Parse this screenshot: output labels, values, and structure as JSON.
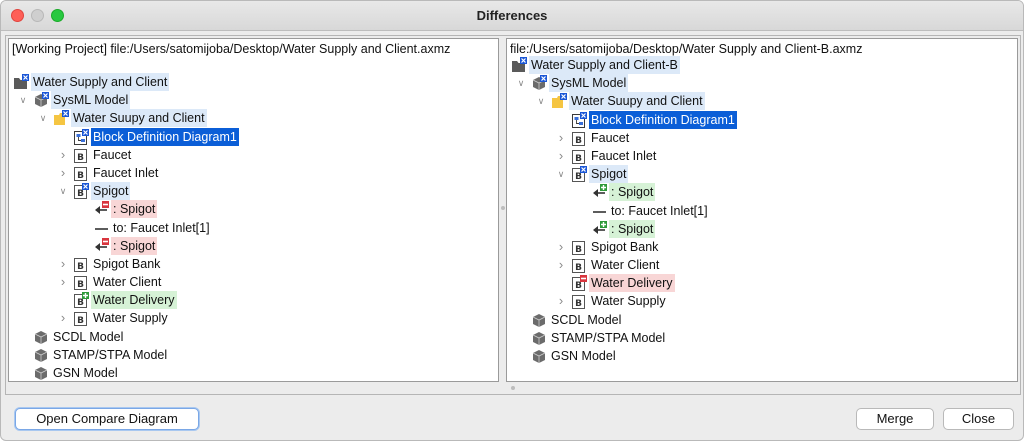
{
  "window": {
    "title": "Differences"
  },
  "left_pane": {
    "header": "[Working Project] file:/Users/satomijoba/Desktop/Water Supply and Client.axmz",
    "rows": [
      {
        "label": "Water Supply and Client",
        "icon": "project-changed-icon",
        "chevron": "",
        "level": 0,
        "state": "chg"
      },
      {
        "label": "SysML Model",
        "icon": "model-changed-icon",
        "chevron": "down",
        "level": 1,
        "state": "chg"
      },
      {
        "label": "Water Suupy and Client",
        "icon": "package-changed-icon",
        "chevron": "down",
        "level": 2,
        "state": "chg"
      },
      {
        "label": "Block Definition Diagram1",
        "icon": "diagram-changed-icon",
        "chevron": "",
        "level": 3,
        "state": "sel"
      },
      {
        "label": "Faucet",
        "icon": "block-icon",
        "chevron": "right",
        "level": 3,
        "state": "plain"
      },
      {
        "label": "Faucet Inlet",
        "icon": "block-icon",
        "chevron": "right",
        "level": 3,
        "state": "plain"
      },
      {
        "label": "Spigot",
        "icon": "block-changed-icon",
        "chevron": "down",
        "level": 3,
        "state": "chg"
      },
      {
        "label": ": Spigot",
        "icon": "part-removed-icon",
        "chevron": "",
        "level": 4,
        "state": "del"
      },
      {
        "label": "to: Faucet Inlet[1]",
        "icon": "association-icon",
        "chevron": "",
        "level": 4,
        "state": "plain"
      },
      {
        "label": ": Spigot",
        "icon": "part-removed-icon",
        "chevron": "",
        "level": 4,
        "state": "del"
      },
      {
        "label": "Spigot Bank",
        "icon": "block-icon",
        "chevron": "right",
        "level": 3,
        "state": "plain"
      },
      {
        "label": "Water Client",
        "icon": "block-icon",
        "chevron": "right",
        "level": 3,
        "state": "plain"
      },
      {
        "label": "Water Delivery",
        "icon": "block-added-icon",
        "chevron": "",
        "level": 3,
        "state": "add"
      },
      {
        "label": "Water Supply",
        "icon": "block-icon",
        "chevron": "right",
        "level": 3,
        "state": "plain"
      },
      {
        "label": "SCDL Model",
        "icon": "model-icon",
        "chevron": "",
        "level": 1,
        "state": "plain"
      },
      {
        "label": "STAMP/STPA Model",
        "icon": "model-icon",
        "chevron": "",
        "level": 1,
        "state": "plain"
      },
      {
        "label": "GSN Model",
        "icon": "model-icon",
        "chevron": "",
        "level": 1,
        "state": "plain"
      }
    ]
  },
  "right_pane": {
    "header": "file:/Users/satomijoba/Desktop/Water Supply and Client-B.axmz",
    "rows": [
      {
        "label": "Water Supply and Client-B",
        "icon": "project-changed-icon",
        "chevron": "",
        "level": 0,
        "state": "chg"
      },
      {
        "label": "SysML Model",
        "icon": "model-changed-icon",
        "chevron": "down",
        "level": 1,
        "state": "chg"
      },
      {
        "label": "Water Suupy and Client",
        "icon": "package-changed-icon",
        "chevron": "down",
        "level": 2,
        "state": "chg"
      },
      {
        "label": "Block Definition Diagram1",
        "icon": "diagram-changed-icon",
        "chevron": "",
        "level": 3,
        "state": "sel"
      },
      {
        "label": "Faucet",
        "icon": "block-icon",
        "chevron": "right",
        "level": 3,
        "state": "plain"
      },
      {
        "label": "Faucet Inlet",
        "icon": "block-icon",
        "chevron": "right",
        "level": 3,
        "state": "plain"
      },
      {
        "label": "Spigot",
        "icon": "block-changed-icon",
        "chevron": "down",
        "level": 3,
        "state": "chg"
      },
      {
        "label": ": Spigot",
        "icon": "part-added-icon",
        "chevron": "",
        "level": 4,
        "state": "add"
      },
      {
        "label": "to: Faucet Inlet[1]",
        "icon": "association-icon",
        "chevron": "",
        "level": 4,
        "state": "plain"
      },
      {
        "label": ": Spigot",
        "icon": "part-added-icon",
        "chevron": "",
        "level": 4,
        "state": "add"
      },
      {
        "label": "Spigot Bank",
        "icon": "block-icon",
        "chevron": "right",
        "level": 3,
        "state": "plain"
      },
      {
        "label": "Water Client",
        "icon": "block-icon",
        "chevron": "right",
        "level": 3,
        "state": "plain"
      },
      {
        "label": "Water Delivery",
        "icon": "block-removed-icon",
        "chevron": "",
        "level": 3,
        "state": "del"
      },
      {
        "label": "Water Supply",
        "icon": "block-icon",
        "chevron": "right",
        "level": 3,
        "state": "plain"
      },
      {
        "label": "SCDL Model",
        "icon": "model-icon",
        "chevron": "",
        "level": 1,
        "state": "plain"
      },
      {
        "label": "STAMP/STPA Model",
        "icon": "model-icon",
        "chevron": "",
        "level": 1,
        "state": "plain"
      },
      {
        "label": "GSN Model",
        "icon": "model-icon",
        "chevron": "",
        "level": 1,
        "state": "plain"
      }
    ]
  },
  "footer": {
    "open_compare_label": "Open Compare Diagram",
    "merge_label": "Merge",
    "close_label": "Close"
  },
  "colors": {
    "selection": "#0b5ed7",
    "changed": "#dce9f8",
    "added": "#d6f2d6",
    "removed": "#f8d6d6",
    "change_badge": "#1a56d6",
    "add_badge": "#2f9a3a",
    "remove_badge": "#d9363e"
  }
}
